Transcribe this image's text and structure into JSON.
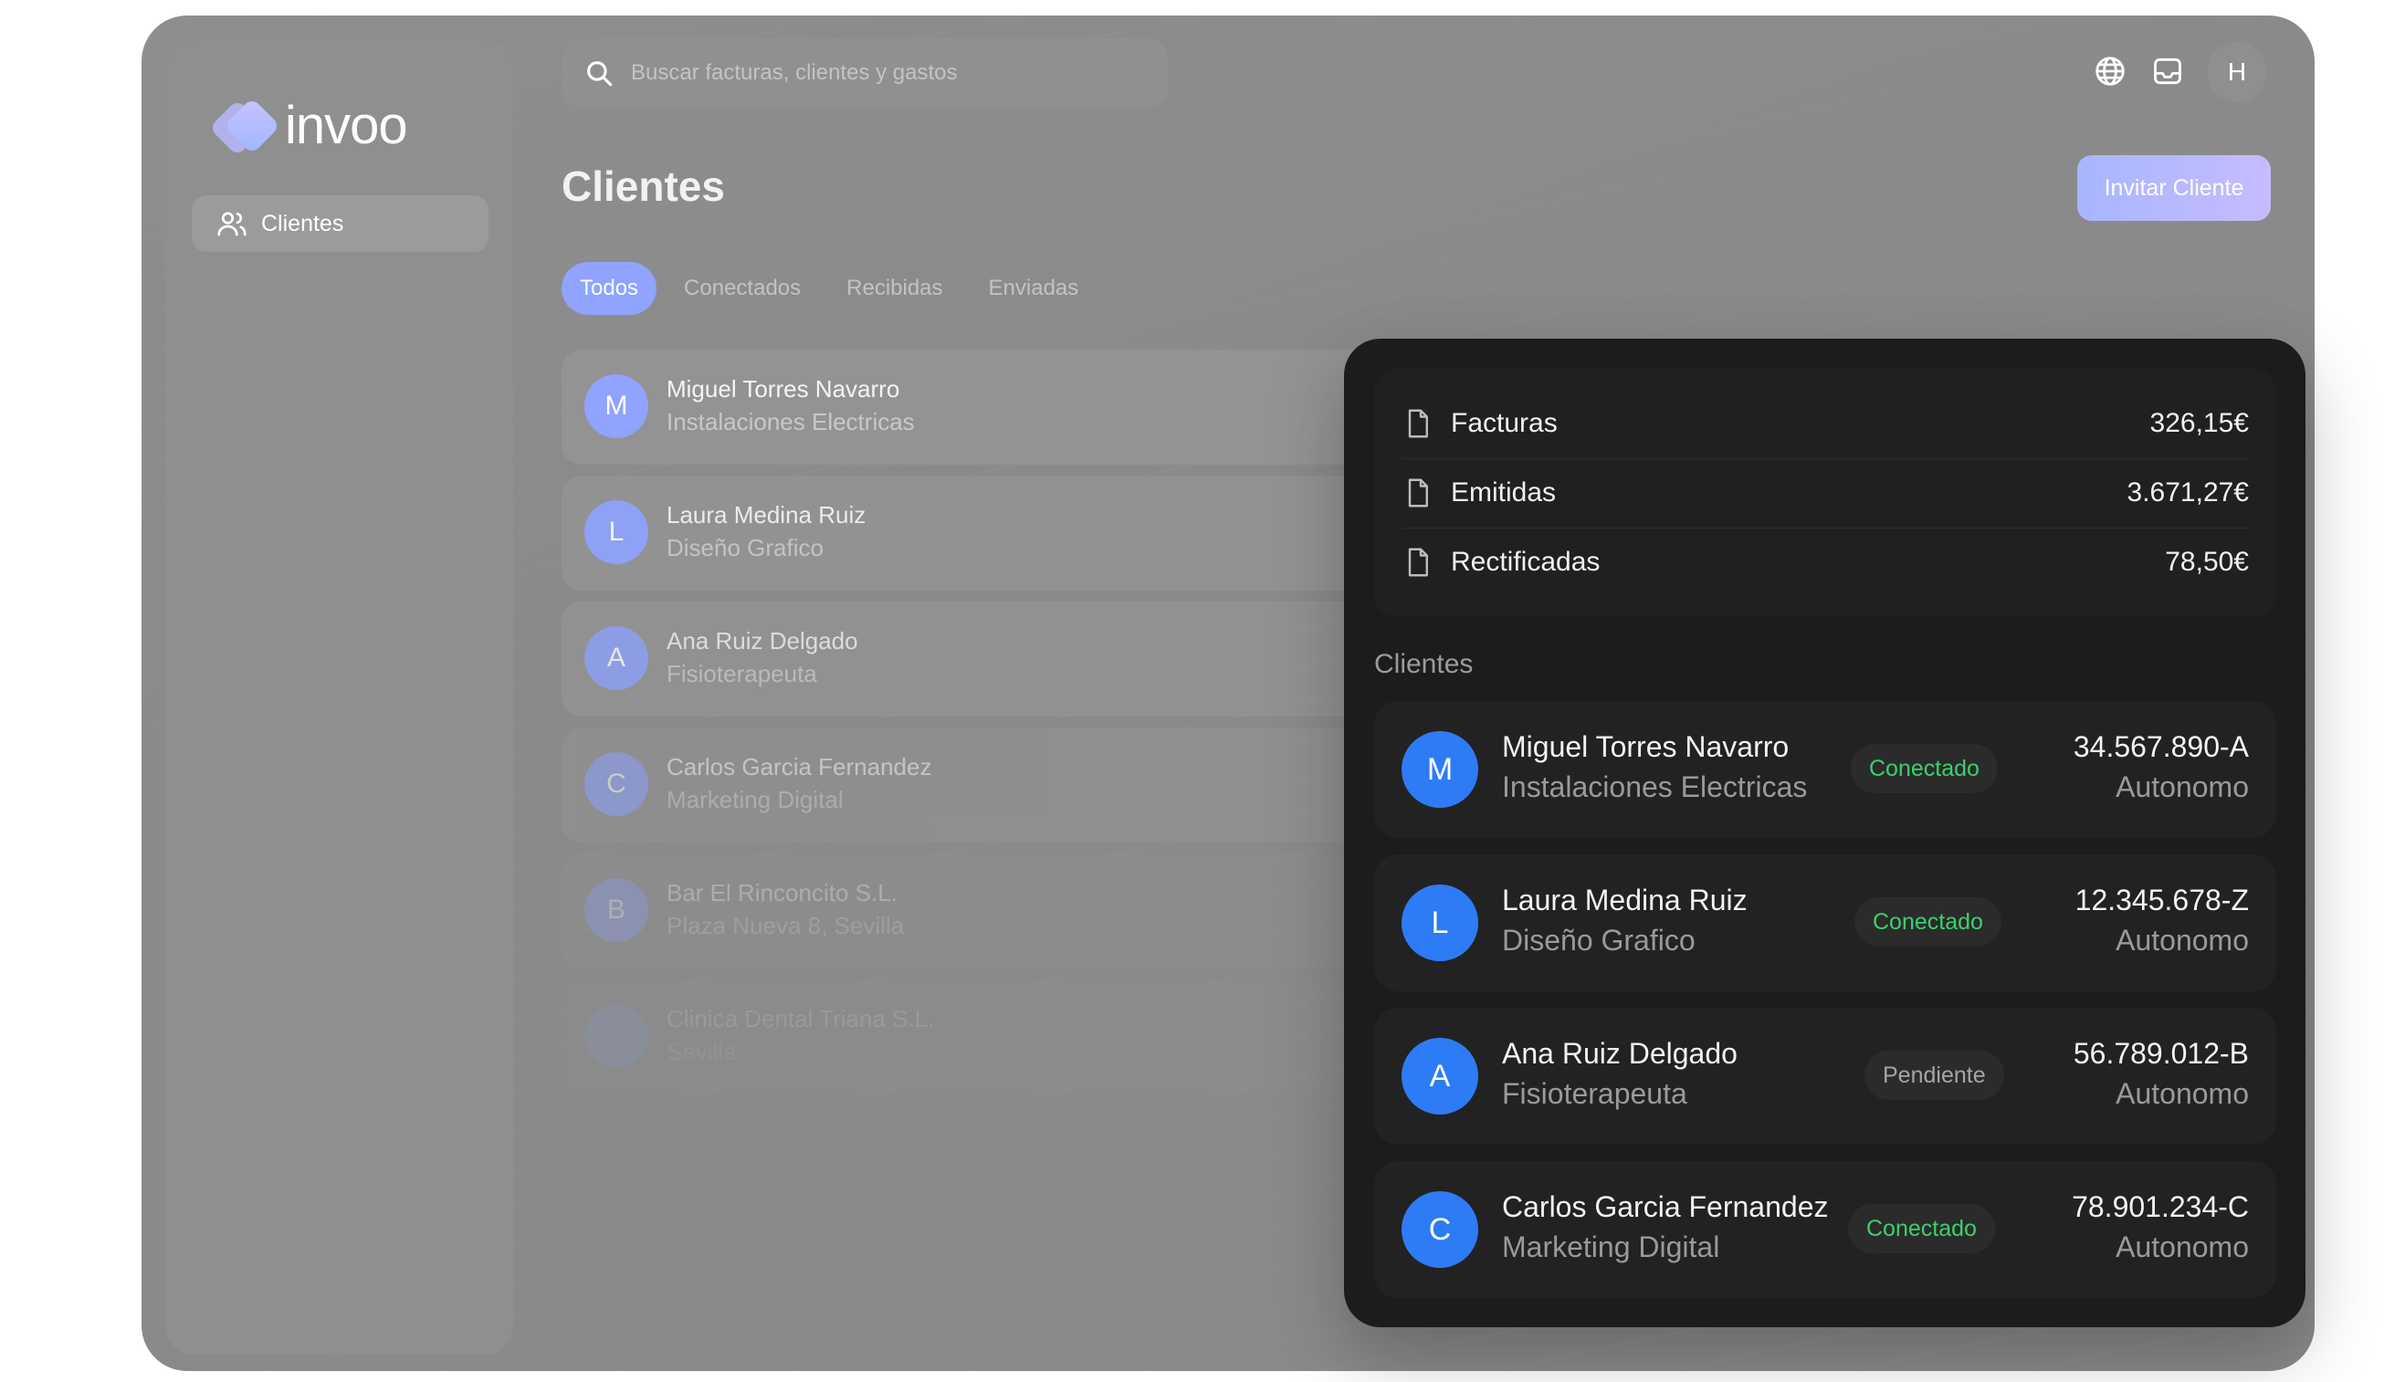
{
  "app": {
    "logo_text": "invoo"
  },
  "sidebar": {
    "items": [
      {
        "label": "Clientes",
        "icon": "users-icon"
      }
    ]
  },
  "search": {
    "placeholder": "Buscar facturas, clientes y gastos"
  },
  "header": {
    "avatar_letter": "H",
    "icons": [
      "globe-icon",
      "inbox-icon"
    ]
  },
  "page": {
    "title": "Clientes",
    "invite_label": "Invitar Cliente"
  },
  "tabs": [
    {
      "label": "Todos",
      "active": true
    },
    {
      "label": "Conectados"
    },
    {
      "label": "Recibidas"
    },
    {
      "label": "Enviadas"
    }
  ],
  "background_list": [
    {
      "initial": "M",
      "name": "Miguel Torres Navarro",
      "sub": "Instalaciones Electricas"
    },
    {
      "initial": "L",
      "name": "Laura Medina Ruiz",
      "sub": "Diseño Grafico"
    },
    {
      "initial": "A",
      "name": "Ana Ruiz Delgado",
      "sub": "Fisioterapeuta"
    },
    {
      "initial": "C",
      "name": "Carlos Garcia Fernandez",
      "sub": "Marketing Digital"
    },
    {
      "initial": "B",
      "name": "Bar El Rinconcito S.L.",
      "sub": "Plaza Nueva 8, Sevilla"
    },
    {
      "initial": "",
      "name": "Clinica Dental Triana S.L.",
      "sub": "Sevilla"
    }
  ],
  "panel": {
    "stats": [
      {
        "label": "Facturas",
        "value": "326,15€"
      },
      {
        "label": "Emitidas",
        "value": "3.671,27€"
      },
      {
        "label": "Rectificadas",
        "value": "78,50€"
      }
    ],
    "section_label": "Clientes",
    "clients": [
      {
        "initial": "M",
        "name": "Miguel Torres Navarro",
        "sub": "Instalaciones Electricas",
        "status": "Conectado",
        "status_kind": "ok",
        "id": "34.567.890-A",
        "type": "Autonomo"
      },
      {
        "initial": "L",
        "name": "Laura Medina Ruiz",
        "sub": "Diseño Grafico",
        "status": "Conectado",
        "status_kind": "ok",
        "id": "12.345.678-Z",
        "type": "Autonomo"
      },
      {
        "initial": "A",
        "name": "Ana Ruiz Delgado",
        "sub": "Fisioterapeuta",
        "status": "Pendiente",
        "status_kind": "pending",
        "id": "56.789.012-B",
        "type": "Autonomo"
      },
      {
        "initial": "C",
        "name": "Carlos Garcia Fernandez",
        "sub": "Marketing Digital",
        "status": "Conectado",
        "status_kind": "ok",
        "id": "78.901.234-C",
        "type": "Autonomo"
      }
    ]
  },
  "colors": {
    "accent": "#8fa3ff",
    "avatar_blue": "#2e7bf6",
    "status_ok": "#3ecf6e",
    "panel_bg": "#1c1c1c"
  }
}
